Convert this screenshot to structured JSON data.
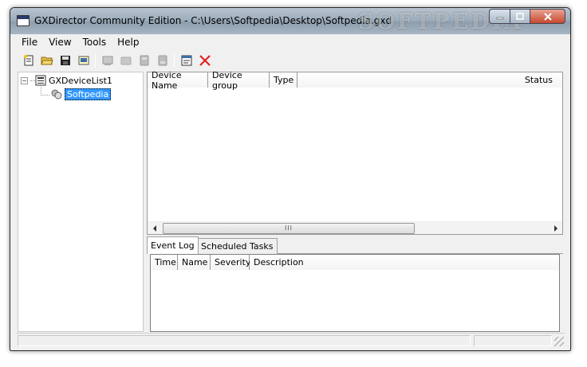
{
  "window": {
    "title": "GXDirector Community Edition - C:\\Users\\Softpedia\\Desktop\\Softpedia.gxd",
    "watermark": "SOFTPEDIA"
  },
  "menu": {
    "items": [
      "File",
      "View",
      "Tools",
      "Help"
    ]
  },
  "toolbar": {
    "buttons": [
      {
        "icon": "new-list-icon"
      },
      {
        "icon": "open-folder-icon"
      },
      {
        "icon": "save-icon"
      },
      {
        "icon": "add-device-icon"
      },
      {
        "icon": "device-action-1-icon"
      },
      {
        "icon": "device-action-2-icon"
      },
      {
        "icon": "device-action-3-icon"
      },
      {
        "icon": "device-action-4-icon"
      },
      {
        "icon": "properties-icon"
      },
      {
        "icon": "delete-icon"
      }
    ]
  },
  "tree": {
    "root": {
      "label": "GXDeviceList1",
      "expander": "⊟"
    },
    "children": [
      {
        "label": "Softpedia",
        "selected": true
      }
    ]
  },
  "device_list": {
    "columns": [
      "Device Name",
      "Device group",
      "Type",
      "Status"
    ],
    "rows": [],
    "scroll_grip": "III"
  },
  "bottom_tabs": {
    "tabs": [
      "Event Log",
      "Scheduled Tasks"
    ],
    "active": "Event Log"
  },
  "event_log": {
    "columns": [
      "Time",
      "Name",
      "Severity",
      "Description"
    ],
    "rows": []
  },
  "colors": {
    "selection": "#3399ff",
    "delete_icon": "#e02020"
  }
}
